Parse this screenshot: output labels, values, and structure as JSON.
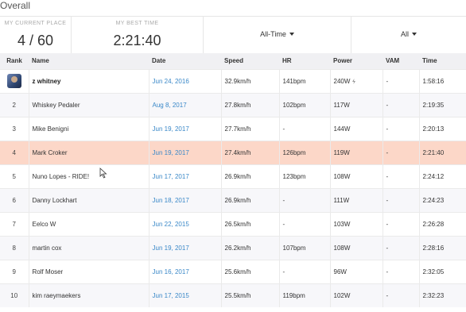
{
  "section_title": "Overall",
  "stats": {
    "current_place_label": "MY CURRENT PLACE",
    "current_place_value": "4 / 60",
    "best_time_label": "MY BEST TIME",
    "best_time_value": "2:21:40"
  },
  "filters": {
    "time_range": "All-Time",
    "group": "All"
  },
  "table": {
    "headers": [
      "Rank",
      "Name",
      "Date",
      "Speed",
      "HR",
      "Power",
      "VAM",
      "Time"
    ],
    "rows": [
      {
        "rank": "",
        "name": "z whitney",
        "date": "Jun 24, 2016",
        "speed": "32.9km/h",
        "hr": "141bpm",
        "power": "240W",
        "vam": "-",
        "time": "1:58:16"
      },
      {
        "rank": "2",
        "name": "Whiskey Pedaler",
        "date": "Aug 8, 2017",
        "speed": "27.8km/h",
        "hr": "102bpm",
        "power": "117W",
        "vam": "-",
        "time": "2:19:35"
      },
      {
        "rank": "3",
        "name": "Mike Benigni",
        "date": "Jun 19, 2017",
        "speed": "27.7km/h",
        "hr": "-",
        "power": "144W",
        "vam": "-",
        "time": "2:20:13"
      },
      {
        "rank": "4",
        "name": "Mark Croker",
        "date": "Jun 19, 2017",
        "speed": "27.4km/h",
        "hr": "126bpm",
        "power": "119W",
        "vam": "-",
        "time": "2:21:40"
      },
      {
        "rank": "5",
        "name": "Nuno Lopes - RIDE!",
        "date": "Jun 17, 2017",
        "speed": "26.9km/h",
        "hr": "123bpm",
        "power": "108W",
        "vam": "-",
        "time": "2:24:12"
      },
      {
        "rank": "6",
        "name": "Danny Lockhart",
        "date": "Jun 18, 2017",
        "speed": "26.9km/h",
        "hr": "-",
        "power": "111W",
        "vam": "-",
        "time": "2:24:23"
      },
      {
        "rank": "7",
        "name": "Eelco W",
        "date": "Jun 22, 2015",
        "speed": "26.5km/h",
        "hr": "-",
        "power": "103W",
        "vam": "-",
        "time": "2:26:28"
      },
      {
        "rank": "8",
        "name": "martin cox",
        "date": "Jun 19, 2017",
        "speed": "26.2km/h",
        "hr": "107bpm",
        "power": "108W",
        "vam": "-",
        "time": "2:28:16"
      },
      {
        "rank": "9",
        "name": "Rolf Moser",
        "date": "Jun 16, 2017",
        "speed": "25.6km/h",
        "hr": "-",
        "power": "96W",
        "vam": "-",
        "time": "2:32:05"
      },
      {
        "rank": "10",
        "name": "kim raeymaekers",
        "date": "Jun 17, 2015",
        "speed": "25.5km/h",
        "hr": "119bpm",
        "power": "102W",
        "vam": "-",
        "time": "2:32:23"
      }
    ]
  },
  "colors": {
    "highlight_row": "#fcd7c8",
    "date_link": "#3a88c8",
    "header_bg": "#f0f0f3"
  },
  "icons": {
    "first_row_avatar": "athlete-avatar",
    "power_badge": "estimated-power-icon"
  }
}
